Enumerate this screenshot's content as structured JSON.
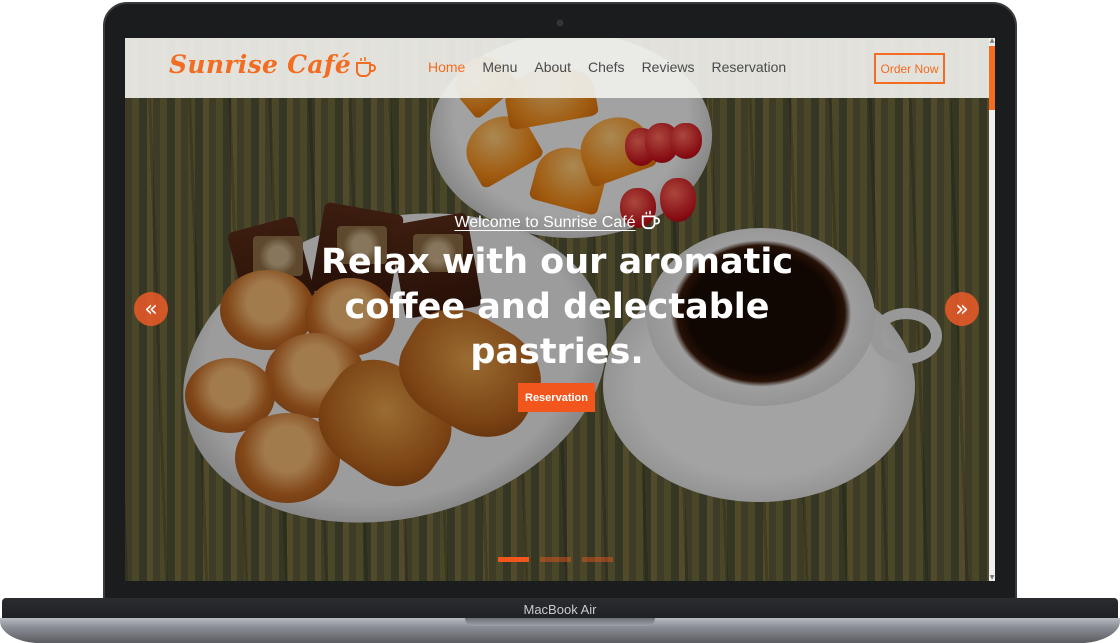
{
  "brand": {
    "name": "Sunrise Café",
    "accent": "#f26c22"
  },
  "nav": {
    "links": [
      {
        "label": "Home",
        "active": true
      },
      {
        "label": "Menu",
        "active": false
      },
      {
        "label": "About",
        "active": false
      },
      {
        "label": "Chefs",
        "active": false
      },
      {
        "label": "Reviews",
        "active": false
      },
      {
        "label": "Reservation",
        "active": false
      }
    ],
    "order_label": "Order Now"
  },
  "hero": {
    "welcome": "Welcome to Sunrise Café",
    "headline": "Relax with our aromatic coffee and delectable pastries.",
    "cta_label": "Reservation",
    "prev_icon": "«",
    "next_icon": "»",
    "slides": 3,
    "active_slide": 1
  },
  "device": {
    "label": "MacBook Air"
  }
}
